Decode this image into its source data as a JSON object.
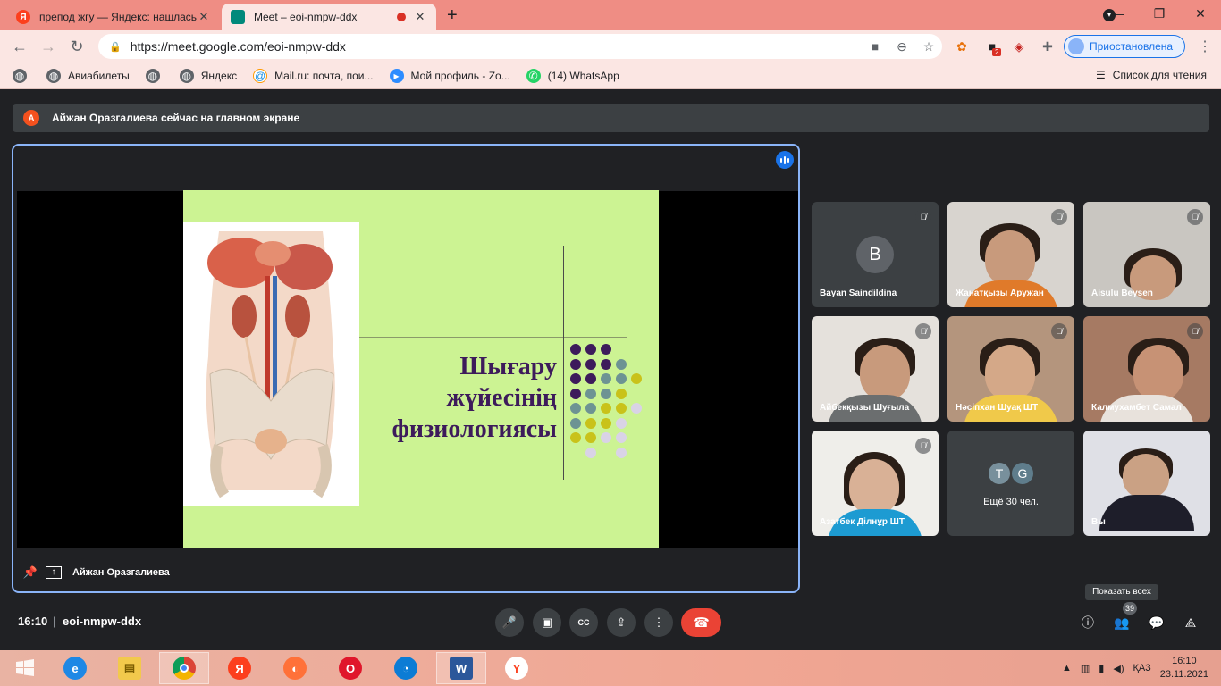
{
  "browser": {
    "tabs": [
      {
        "title": "препод жгу — Яндекс: нашлась",
        "favicon_letter": "Я",
        "close": "✕"
      },
      {
        "title": "Meet – eoi-nmpw-ddx",
        "close": "✕"
      }
    ],
    "new_tab": "+",
    "window_controls": [
      "—",
      "❐",
      "✕"
    ],
    "url": "https://meet.google.com/eoi-nmpw-ddx",
    "profile_label": "Приостановлена",
    "ext_badge": "2",
    "bookmarks": [
      {
        "label": "Авиабилеты",
        "icon": "globe-icon"
      },
      {
        "label": "Яндекс",
        "icon": "globe-icon"
      },
      {
        "label": "Mail.ru: почта, пои...",
        "icon": "mailru-icon"
      },
      {
        "label": "Мой профиль - Zo...",
        "icon": "zoom-icon"
      },
      {
        "label": "(14) WhatsApp",
        "icon": "whatsapp-icon"
      }
    ],
    "reading_list": "Список для чтения"
  },
  "meet": {
    "notice": {
      "avatar_letter": "А",
      "text": "Айжан Оразгалиева сейчас на главном экране"
    },
    "presenter_name": "Айжан Оразгалиева",
    "slide": {
      "title_lines": [
        "Шығару",
        "жүйесінің",
        "физиологиясы"
      ],
      "colors": {
        "background": "#ccf393",
        "title": "#3d1b5b",
        "purple": "#3d1b5b",
        "teal": "#6d9393",
        "olive": "#c9c21a",
        "lavender": "#d9d3e6"
      }
    },
    "participants": [
      {
        "name": "Bayan Saindildina",
        "avatar_letter": "B",
        "type": "avatar"
      },
      {
        "name": "Жанатқызы Аружан",
        "type": "video",
        "bg": "#d8d4cf",
        "shirt": "#e07a2a"
      },
      {
        "name": "Aisulu Beysen",
        "type": "video",
        "bg": "#c9c6c1",
        "shirt": "#e2ddd6"
      },
      {
        "name": "Айбекқызы Шуғыла",
        "type": "video",
        "bg": "#e5e1dc",
        "shirt": "#6b6e6f"
      },
      {
        "name": "Нәсіпхан Шуақ ШТ",
        "type": "video",
        "bg": "#b4957d",
        "shirt": "#f0c94a"
      },
      {
        "name": "Калмухамбет Самал",
        "type": "video",
        "bg": "#a67a63",
        "shirt": "#e8e2dc"
      },
      {
        "name": "Азатбек Ділнұр ШТ",
        "type": "video",
        "bg": "#efeeea",
        "shirt": "#1d9bd2"
      },
      {
        "name": "Вы",
        "type": "video",
        "bg": "#dfe0e6",
        "shirt": "#1e1e2a"
      }
    ],
    "more": {
      "label": "Ещё 30 чел.",
      "avatars": [
        {
          "letter": "T",
          "color": "#78909c"
        },
        {
          "letter": "G",
          "color": "#5f7d8c"
        }
      ]
    },
    "tooltip": "Показать всех",
    "people_count": "39",
    "time": "16:10",
    "separator": "|",
    "meeting_code": "eoi-nmpw-ddx"
  },
  "taskbar": {
    "lang": "ҚАЗ",
    "time": "16:10",
    "date": "23.11.2021"
  }
}
